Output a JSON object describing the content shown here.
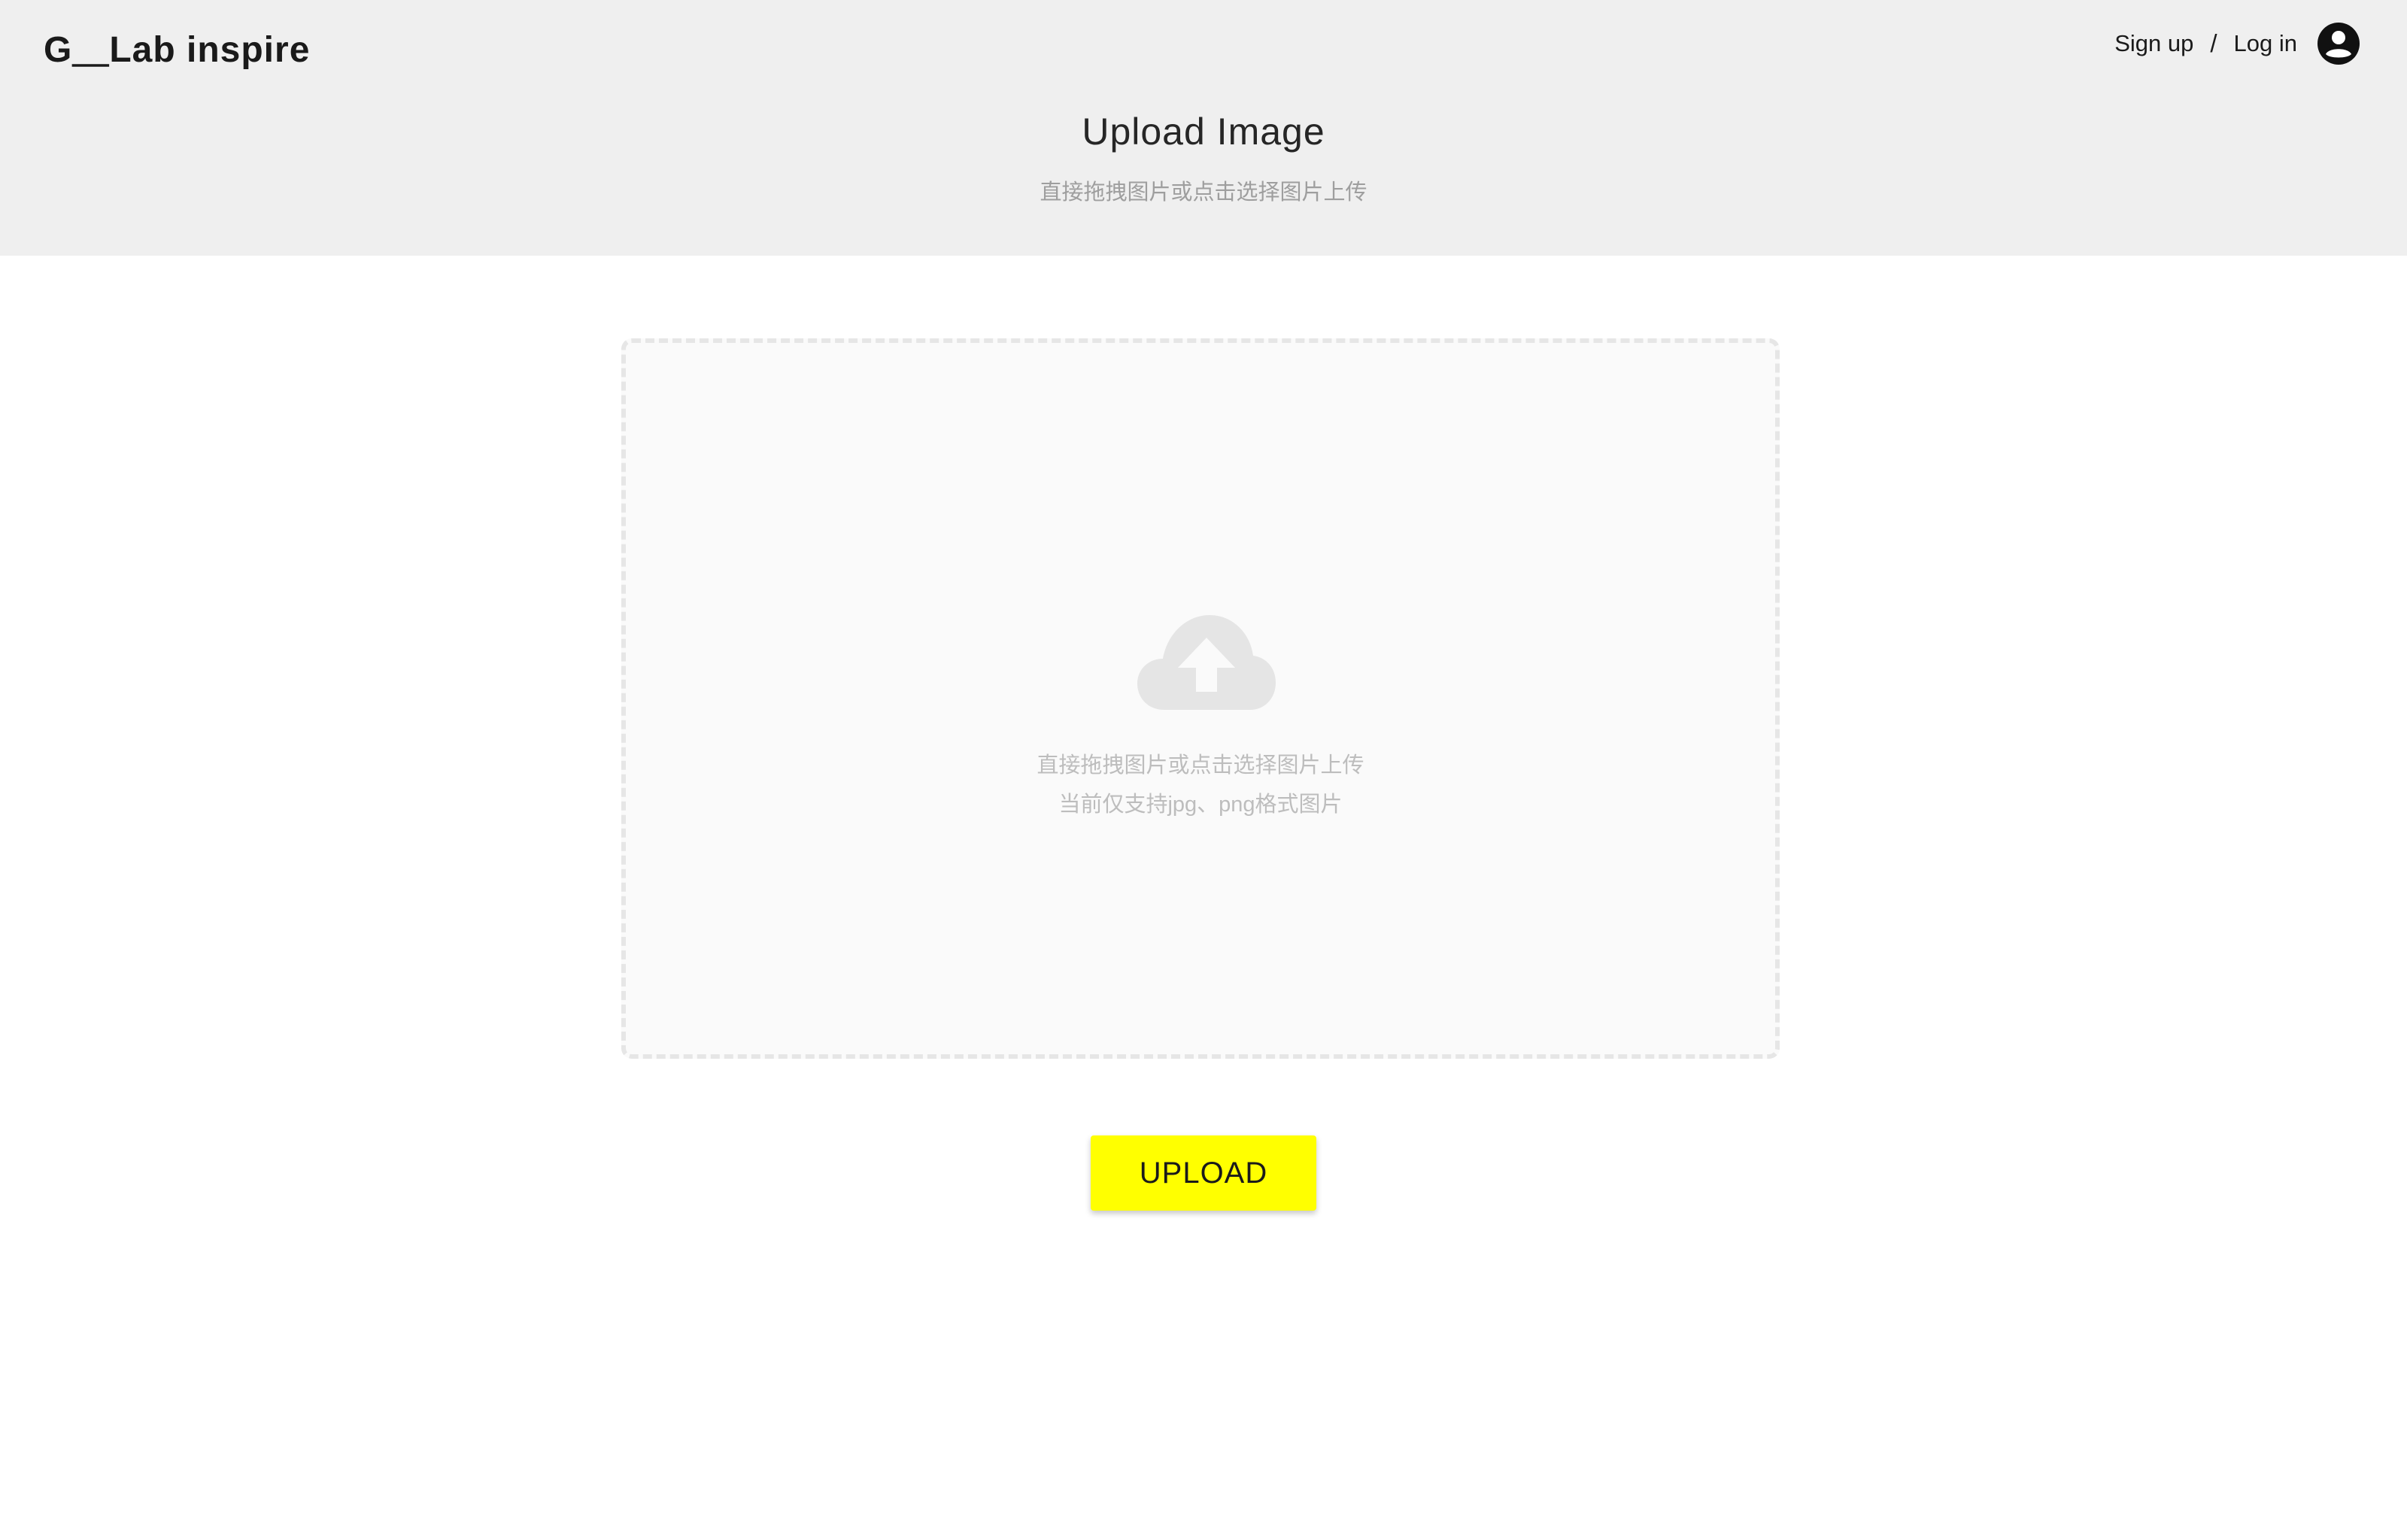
{
  "header": {
    "logo": "G＿Lab inspire",
    "signup_label": "Sign up",
    "separator": "/",
    "login_label": "Log in",
    "avatar_icon": "account-circle-icon",
    "background": "#efefef"
  },
  "main": {
    "title": "Upload Image",
    "subtitle": "直接拖拽图片或点击选择图片上传"
  },
  "dropzone": {
    "icon": "cloud-upload-icon",
    "line1": "直接拖拽图片或点击选择图片上传",
    "line2": "当前仅支持jpg、png格式图片"
  },
  "actions": {
    "upload_label": "UPLOAD",
    "upload_color": "#ffff00"
  }
}
